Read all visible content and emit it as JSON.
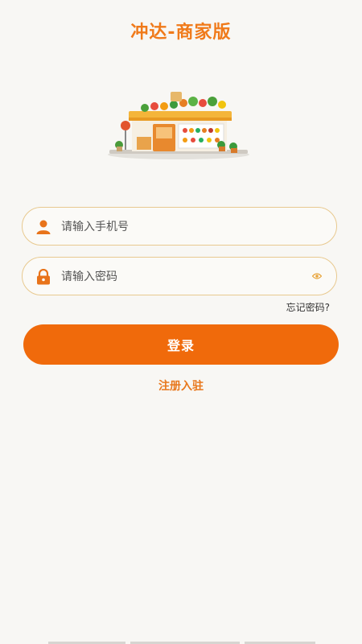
{
  "app": {
    "title": "冲达-商家版"
  },
  "form": {
    "phone_placeholder": "请输入手机号",
    "password_placeholder": "请输入密码",
    "forgot_label": "忘记密码?",
    "login_label": "登录",
    "register_label": "注册入驻"
  },
  "icons": {
    "user": "user-icon",
    "lock": "lock-icon",
    "eye": "eye-icon"
  },
  "colors": {
    "accent": "#f06a0b",
    "title": "#f07a1a",
    "field_border": "#e8c98f",
    "background": "#f8f7f4"
  }
}
